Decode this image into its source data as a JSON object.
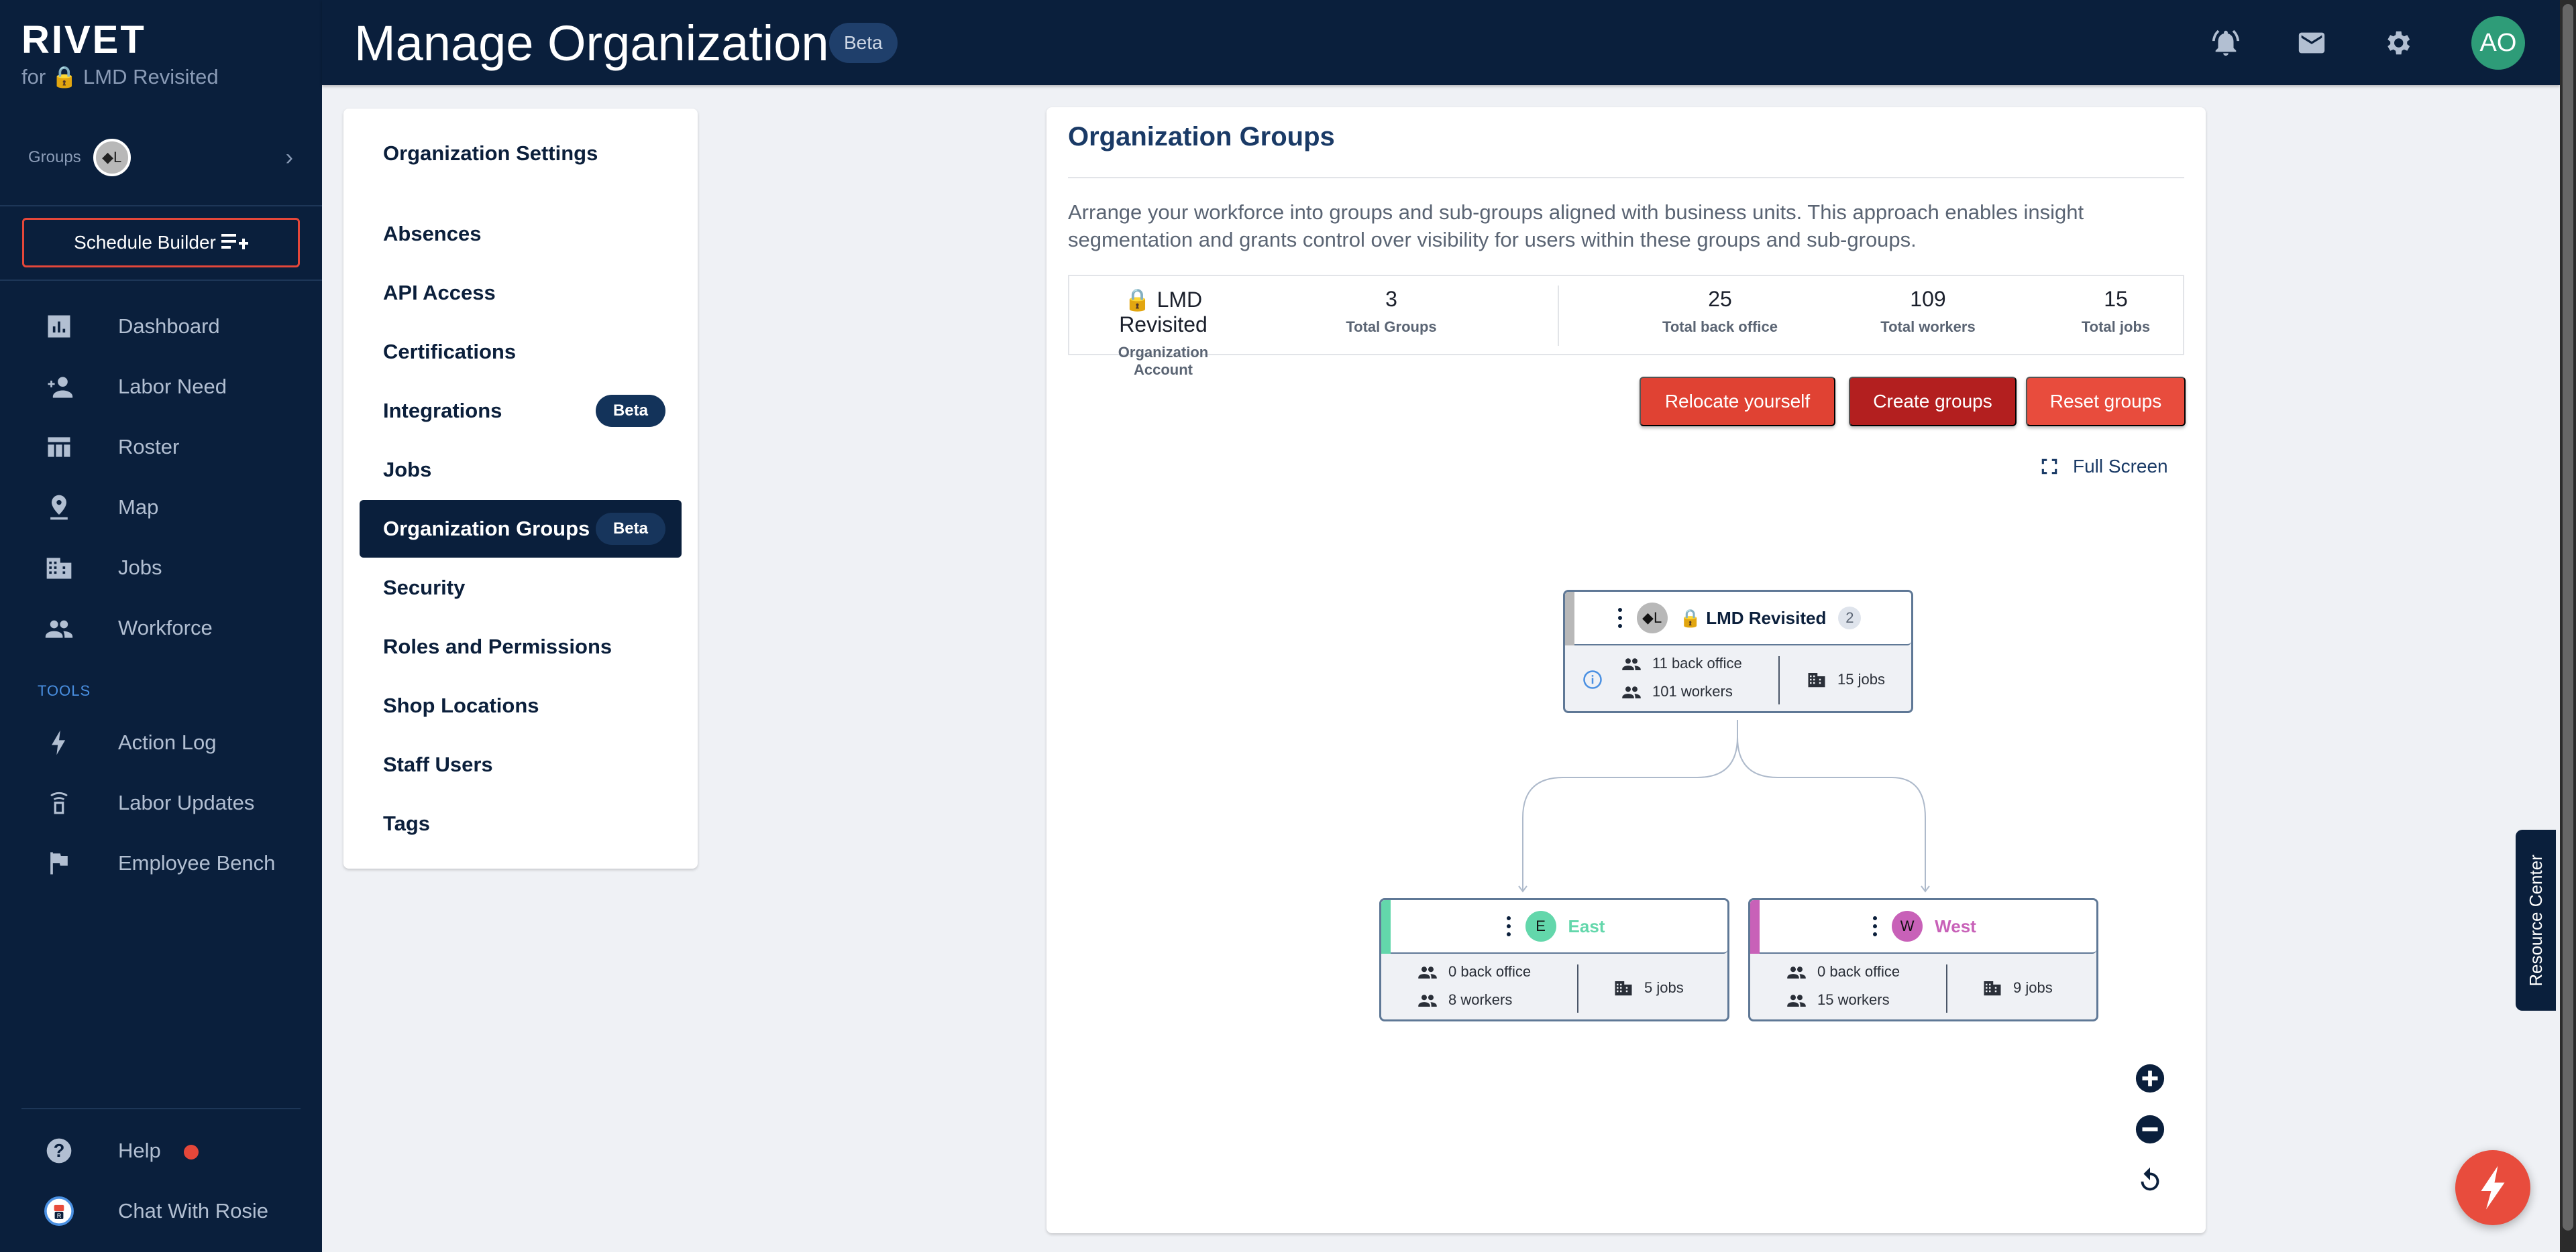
{
  "sidebar": {
    "brand": "RIVET",
    "brand_sub": "for 🔒 LMD Revisited",
    "groups_label": "Groups",
    "groups_avatar": "◆L",
    "schedule_builder": "Schedule Builder",
    "nav": [
      {
        "label": "Dashboard",
        "icon": "dashboard-icon"
      },
      {
        "label": "Labor Need",
        "icon": "person-add-icon"
      },
      {
        "label": "Roster",
        "icon": "table-icon"
      },
      {
        "label": "Map",
        "icon": "map-pin-icon"
      },
      {
        "label": "Jobs",
        "icon": "building-icon"
      },
      {
        "label": "Workforce",
        "icon": "people-icon"
      }
    ],
    "tools_label": "TOOLS",
    "tools": [
      {
        "label": "Action Log",
        "icon": "bolt-icon"
      },
      {
        "label": "Labor Updates",
        "icon": "broadcast-icon"
      },
      {
        "label": "Employee Bench",
        "icon": "flag-icon"
      }
    ],
    "footer": [
      {
        "label": "Help",
        "icon": "help-icon",
        "has_notification": true
      },
      {
        "label": "Chat With Rosie",
        "icon": "rosie-bot-icon"
      }
    ]
  },
  "header": {
    "title": "Manage Organization",
    "badge": "Beta",
    "avatar_initials": "AO",
    "icons": [
      "notification-bell-icon",
      "mail-icon",
      "settings-gear-icon"
    ]
  },
  "settings_menu": {
    "heading": "Organization Settings",
    "items": [
      {
        "label": "Absences"
      },
      {
        "label": "API Access"
      },
      {
        "label": "Certifications"
      },
      {
        "label": "Integrations",
        "badge": "Beta"
      },
      {
        "label": "Jobs"
      },
      {
        "label": "Organization Groups",
        "badge": "Beta",
        "active": true
      },
      {
        "label": "Security"
      },
      {
        "label": "Roles and Permissions"
      },
      {
        "label": "Shop Locations"
      },
      {
        "label": "Staff Users"
      },
      {
        "label": "Tags"
      }
    ]
  },
  "main": {
    "title": "Organization Groups",
    "description": "Arrange your workforce into groups and sub-groups aligned with business units. This approach enables insight segmentation and grants control over visibility for users within these groups and sub-groups.",
    "stats": [
      {
        "value": "🔒 LMD Revisited",
        "label": "Organization Account"
      },
      {
        "value": "3",
        "label": "Total Groups"
      },
      {
        "value": "25",
        "label": "Total back office"
      },
      {
        "value": "109",
        "label": "Total workers"
      },
      {
        "value": "15",
        "label": "Total jobs"
      }
    ],
    "buttons": {
      "relocate": "Relocate yourself",
      "create": "Create groups",
      "reset": "Reset groups"
    },
    "full_screen": "Full Screen"
  },
  "tree": {
    "root": {
      "avatar": "◆L",
      "name": "🔒 LMD Revisited",
      "child_count": "2",
      "back_office": "11 back office",
      "workers": "101 workers",
      "jobs": "15 jobs",
      "color": "#b8b8b8"
    },
    "children": [
      {
        "avatar": "E",
        "name": "East",
        "back_office": "0 back office",
        "workers": "8 workers",
        "jobs": "5 jobs",
        "color": "#63d7ab"
      },
      {
        "avatar": "W",
        "name": "West",
        "back_office": "0 back office",
        "workers": "15 workers",
        "jobs": "9 jobs",
        "color": "#c861b8"
      }
    ]
  },
  "floating": {
    "resource_center": "Resource Center"
  },
  "colors": {
    "navy": "#0a1f3c",
    "accent_red": "#e84c3d",
    "dark_red": "#b31f1f",
    "avatar_green": "#2e9c78"
  }
}
